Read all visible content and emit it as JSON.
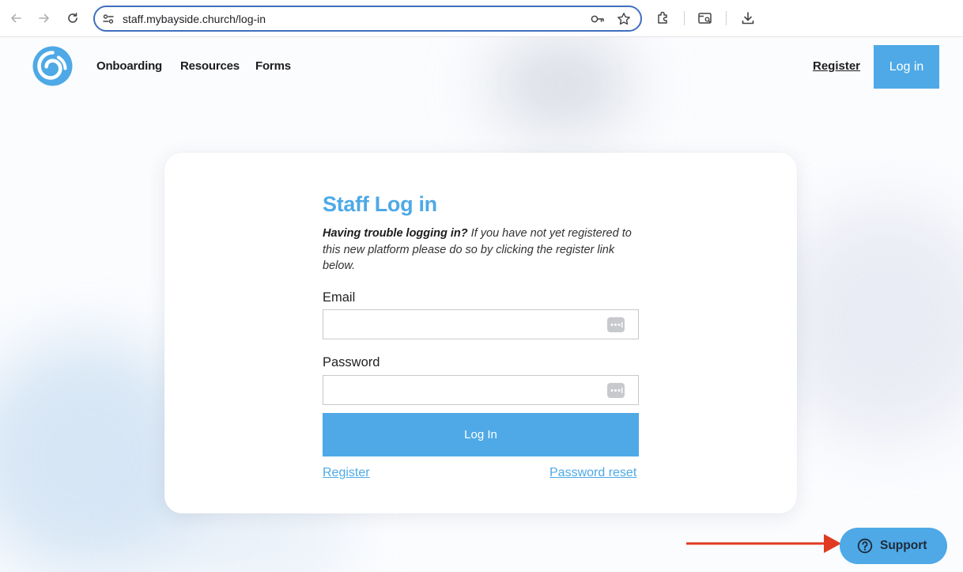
{
  "browser": {
    "url": "staff.mybayside.church/log-in",
    "icons": [
      "back-arrow-icon",
      "forward-arrow-icon",
      "reload-icon",
      "site-info-icon",
      "key-icon",
      "star-icon",
      "extensions-icon",
      "tab-search-icon",
      "download-icon"
    ]
  },
  "header": {
    "logo": "bayside-swirl-logo",
    "nav": [
      "Onboarding",
      "Resources",
      "Forms"
    ],
    "register_label": "Register",
    "login_label": "Log in"
  },
  "login_card": {
    "title": "Staff Log in",
    "trouble_lead": "Having trouble logging in?",
    "trouble_text": " If you have not yet registered to this new platform please do so by clicking the register link below.",
    "email_label": "Email",
    "email_value": "",
    "password_label": "Password",
    "password_value": "",
    "submit_label": "Log In",
    "register_link": "Register",
    "password_reset_link": "Password reset"
  },
  "support": {
    "label": "Support",
    "icon": "question-circle-icon"
  },
  "colors": {
    "accent": "#4ea9e6",
    "annotation_arrow": "#e03a22",
    "omnibox_focus": "#3f6fbf"
  }
}
